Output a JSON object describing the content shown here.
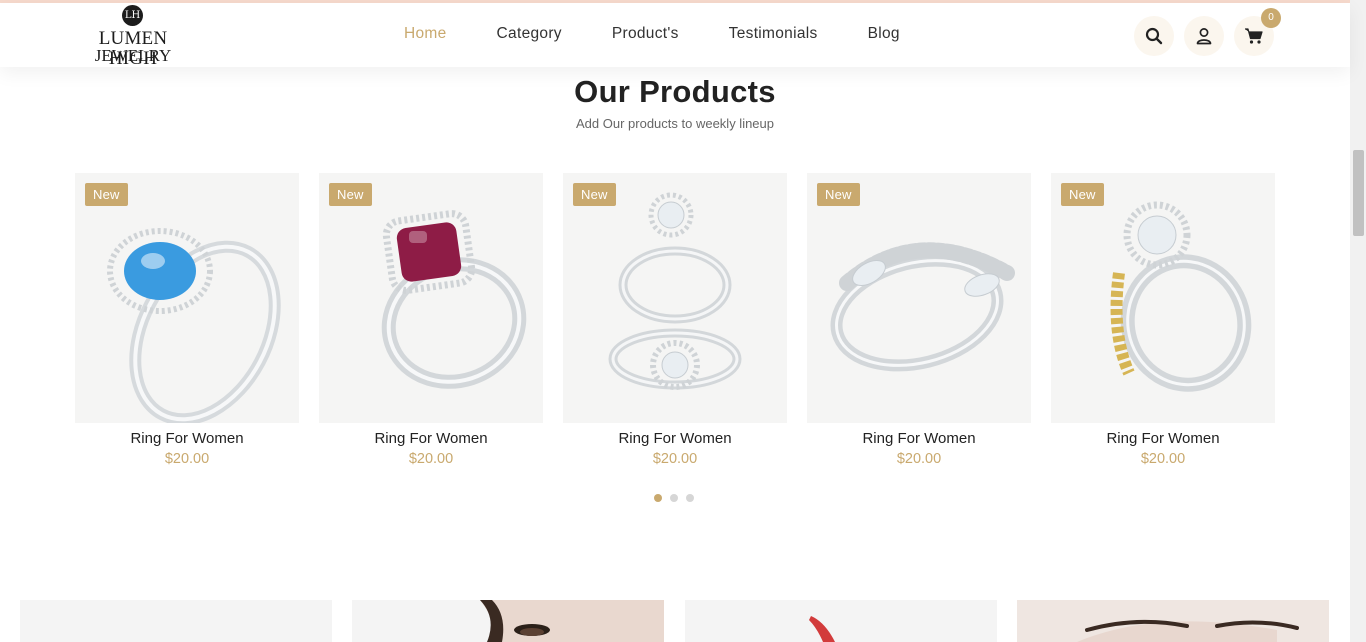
{
  "brand": {
    "badge": "LH",
    "line1": "LUMEN HIGH",
    "line2": "JEWELRY"
  },
  "nav": [
    {
      "label": "Home",
      "active": true
    },
    {
      "label": "Category",
      "active": false
    },
    {
      "label": "Product's",
      "active": false
    },
    {
      "label": "Testimonials",
      "active": false
    },
    {
      "label": "Blog",
      "active": false
    }
  ],
  "header_icons": {
    "search": "search-icon",
    "user": "user-icon",
    "cart": "cart-icon"
  },
  "cart": {
    "count": "0"
  },
  "section": {
    "title": "Our Products",
    "subtitle": "Add Our products to weekly lineup"
  },
  "products": [
    {
      "badge": "New",
      "name": "Ring For Women",
      "price": "$20.00",
      "stone": "#3a9be0"
    },
    {
      "badge": "New",
      "name": "Ring For Women",
      "price": "$20.00",
      "stone": "#8e1c46"
    },
    {
      "badge": "New",
      "name": "Ring For Women",
      "price": "$20.00",
      "stone": "#e9eef2"
    },
    {
      "badge": "New",
      "name": "Ring For Women",
      "price": "$20.00",
      "stone": "#e9eef2"
    },
    {
      "badge": "New",
      "name": "Ring For Women",
      "price": "$20.00",
      "stone": "#e9eef2"
    }
  ],
  "carousel": {
    "pages": 3,
    "active": 1
  },
  "colors": {
    "accent": "#c9a96e",
    "card_bg": "#f5f5f4",
    "top_accent": "#f6d9cc"
  }
}
